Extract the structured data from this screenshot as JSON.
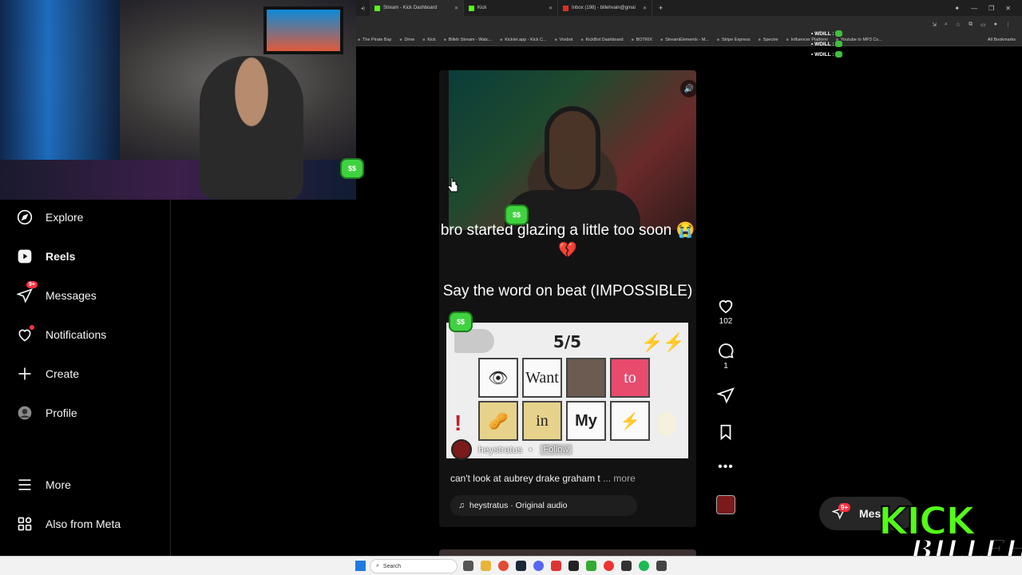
{
  "browser": {
    "tabs": [
      {
        "label": "Stream - Kick Dashboard",
        "icon": "kick-icon",
        "active": true
      },
      {
        "label": "Kick",
        "icon": "kick-icon",
        "active": false
      },
      {
        "label": "Inbox (198) - billehvain@gmai",
        "icon": "gmail-icon",
        "active": false
      }
    ],
    "new_tab": "+",
    "bookmarks": [
      "The Pirate Bay",
      "Drive",
      "Kick",
      "Billeh Stream - Watc...",
      "Kicklet.app - Kick C...",
      "Voxbot",
      "KickBot Dashboard",
      "BOTRIX",
      "StreamElements - M...",
      "Stripe Express",
      "Spectre",
      "Influencer Platform",
      "Youtube to MP3 Co..."
    ],
    "all_bookmarks": "All Bookmarks"
  },
  "chat_overlay": {
    "lines": [
      "WDILL :",
      "WDILL :",
      "WDILL :"
    ]
  },
  "webcam": {
    "badge_text": "$$"
  },
  "sidebar": {
    "items": [
      {
        "label": "Explore",
        "icon": "compass-icon"
      },
      {
        "label": "Reels",
        "icon": "reels-icon"
      },
      {
        "label": "Messages",
        "icon": "messenger-icon",
        "badge": "9+"
      },
      {
        "label": "Notifications",
        "icon": "heart-icon"
      },
      {
        "label": "Create",
        "icon": "plus-icon"
      },
      {
        "label": "Profile",
        "icon": "profile-avatar-icon"
      },
      {
        "label": "More",
        "icon": "hamburger-icon"
      },
      {
        "label": "Also from Meta",
        "icon": "meta-grid-icon"
      }
    ]
  },
  "reel": {
    "caption_top": "bro started glazing a little too soon 😭💔",
    "caption_mid": "Say the word on beat (IMPOSSIBLE)",
    "sticker_text": "$$",
    "game": {
      "title": "5/5",
      "row1": [
        "",
        "Want",
        "",
        "to"
      ],
      "row2": [
        "",
        "in",
        "My",
        ""
      ]
    },
    "username": "heystratus",
    "dot": "•",
    "follow": "Follow",
    "description": "can't look at aubrey drake graham t",
    "more": "... more",
    "audio": "heystratus · Original audio"
  },
  "actions": {
    "likes": "102",
    "comments": "1"
  },
  "messages_pill": {
    "label": "Mes",
    "badge": "9+"
  },
  "logo": {
    "top": "KICK",
    "bottom": "BILLEH"
  },
  "taskbar": {
    "search_placeholder": "Search"
  }
}
